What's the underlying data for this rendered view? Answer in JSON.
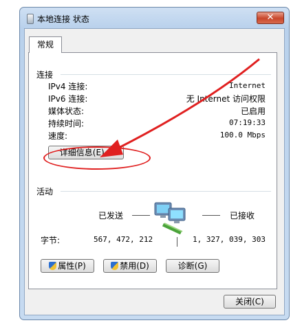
{
  "window": {
    "title": "本地连接 状态",
    "close_label": "✕"
  },
  "tabs": [
    {
      "label": "常规"
    }
  ],
  "connection": {
    "group_label": "连接",
    "rows": [
      {
        "label": "IPv4 连接:",
        "value": "Internet"
      },
      {
        "label": "IPv6 连接:",
        "value": "无 Internet 访问权限"
      },
      {
        "label": "媒体状态:",
        "value": "已启用"
      },
      {
        "label": "持续时间:",
        "value": "07:19:33"
      },
      {
        "label": "速度:",
        "value": "100.0 Mbps"
      }
    ],
    "details_button": "详细信息(E)..."
  },
  "activity": {
    "group_label": "活动",
    "sent_label": "已发送",
    "received_label": "已接收",
    "bytes_label": "字节:",
    "bytes_sent": "567, 472, 212",
    "bytes_received": "1, 327, 039, 303"
  },
  "buttons": {
    "properties": "属性(P)",
    "disable": "禁用(D)",
    "diagnose": "诊断(G)",
    "close": "关闭(C)"
  },
  "colors": {
    "annotation": "#e02020"
  }
}
